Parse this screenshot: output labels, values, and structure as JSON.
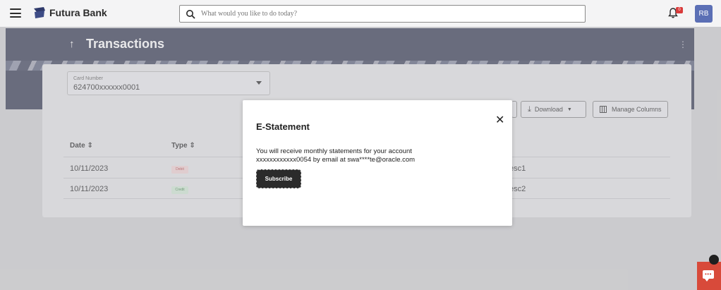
{
  "header": {
    "brand": "Futura Bank",
    "search_placeholder": "What would you like to do today?",
    "notification_badge": "0",
    "avatar_initials": "RB"
  },
  "page": {
    "title": "Transactions"
  },
  "filters": {
    "card_number_label": "Card Number",
    "card_number_value": "624700xxxxxx0001"
  },
  "toolbar": {
    "download_label": "Download",
    "manage_columns_label": "Manage Columns"
  },
  "table": {
    "columns": [
      "Date",
      "Type"
    ],
    "rows": [
      {
        "date": "10/11/2023",
        "type": "Debit",
        "desc_fragment": "esc1"
      },
      {
        "date": "10/11/2023",
        "type": "Credit",
        "desc_fragment": "esc2"
      }
    ]
  },
  "modal": {
    "title": "E-Statement",
    "message": "You will receive monthly statements for your account xxxxxxxxxxxx0054 by email at swa****te@oracle.com",
    "subscribe_label": "Subscribe",
    "close_glyph": "✕"
  },
  "colors": {
    "banner": "#3d4158",
    "avatar": "#5b6fb5",
    "chat": "#d84a3a",
    "debit": "#b84a4a",
    "credit": "#4a8a52"
  }
}
